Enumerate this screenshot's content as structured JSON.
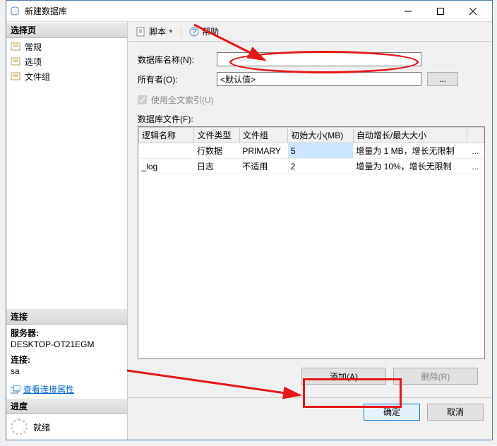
{
  "window": {
    "title": "新建数据库"
  },
  "sidebar": {
    "select_header": "选择页",
    "items": [
      {
        "label": "常规"
      },
      {
        "label": "选项"
      },
      {
        "label": "文件组"
      }
    ],
    "conn_header": "连接",
    "server_label": "服务器:",
    "server_value": "DESKTOP-OT21EGM",
    "conn_label": "连接:",
    "conn_value": "sa",
    "view_props": "查看连接属性",
    "progress_header": "进度",
    "progress_value": "就绪"
  },
  "toolbar": {
    "script_label": "脚本",
    "help_label": "帮助"
  },
  "form": {
    "dbname_label": "数据库名称(N):",
    "dbname_value": "",
    "owner_label": "所有者(O):",
    "owner_value": "<默认值>",
    "browse_label": "...",
    "fulltext_label": "使用全文索引(U)",
    "files_label": "数据库文件(F):"
  },
  "table": {
    "headers": [
      "逻辑名称",
      "文件类型",
      "文件组",
      "初始大小(MB)",
      "自动增长/最大大小",
      ""
    ],
    "rows": [
      {
        "name": "",
        "type": "行数据",
        "group": "PRIMARY",
        "size": "5",
        "growth": "增量为 1 MB，增长无限制",
        "ell": "..."
      },
      {
        "name": "_log",
        "type": "日志",
        "group": "不适用",
        "size": "2",
        "growth": "增量为 10%，增长无限制",
        "ell": "..."
      }
    ]
  },
  "buttons": {
    "add": "添加(A)",
    "remove": "删除(R)",
    "ok": "确定",
    "cancel": "取消"
  }
}
